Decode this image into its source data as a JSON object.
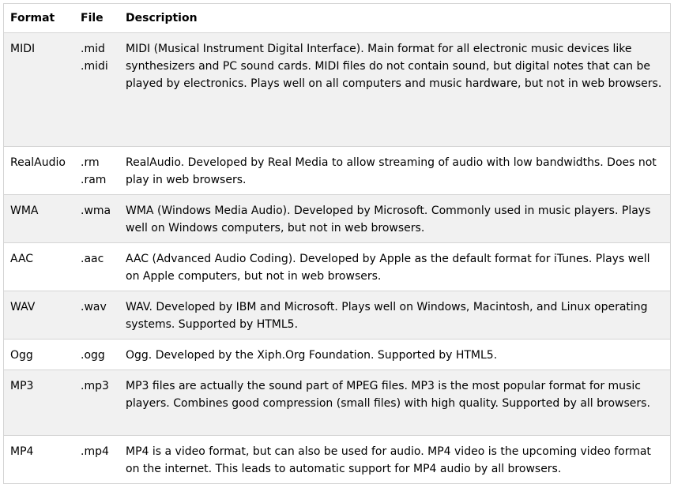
{
  "headers": {
    "format": "Format",
    "file": "File",
    "description": "Description"
  },
  "rows": [
    {
      "format": "MIDI",
      "files": [
        ".mid",
        ".midi"
      ],
      "description": "MIDI (Musical Instrument Digital Interface). Main format for all electronic music devices like synthesizers and PC sound cards. MIDI files do not contain sound, but digital notes that can be played by electronics. Plays well on all computers and music hardware, but not in web browsers."
    },
    {
      "format": "RealAudio",
      "files": [
        ".rm",
        ".ram"
      ],
      "description": "RealAudio. Developed by Real Media to allow streaming of audio with low bandwidths. Does not play in web browsers."
    },
    {
      "format": "WMA",
      "files": [
        ".wma"
      ],
      "description": "WMA (Windows Media Audio). Developed by Microsoft. Commonly used in music players. Plays well on Windows computers, but not in web browsers."
    },
    {
      "format": "AAC",
      "files": [
        ".aac"
      ],
      "description": "AAC (Advanced Audio Coding). Developed by Apple as the default format for iTunes. Plays well on Apple computers, but not in web browsers."
    },
    {
      "format": "WAV",
      "files": [
        ".wav"
      ],
      "description": "WAV. Developed by IBM and Microsoft. Plays well on Windows, Macintosh, and Linux operating systems. Supported by HTML5."
    },
    {
      "format": "Ogg",
      "files": [
        ".ogg"
      ],
      "description": "Ogg. Developed by the Xiph.Org Foundation. Supported by HTML5."
    },
    {
      "format": "MP3",
      "files": [
        ".mp3"
      ],
      "description": "MP3 files are actually the sound part of MPEG files. MP3 is the most popular format for music players. Combines good compression (small files) with high quality. Supported by all browsers."
    },
    {
      "format": "MP4",
      "files": [
        ".mp4"
      ],
      "description": "MP4 is a video format, but can also be used for audio. MP4 video is the upcoming video format on the internet. This leads to automatic support for MP4 audio by all browsers."
    }
  ],
  "colors": {
    "odd_row_bg": "#f1f1f1",
    "even_row_bg": "#ffffff",
    "border": "#d4d4d4",
    "text": "#000000"
  }
}
